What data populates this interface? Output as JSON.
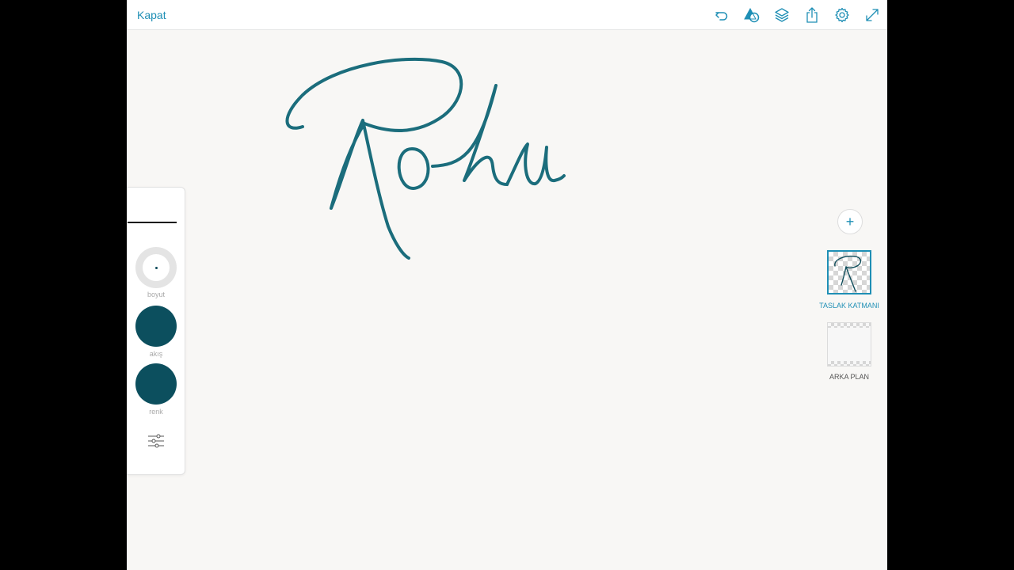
{
  "topbar": {
    "close_label": "Kapat",
    "icons": [
      "undo-icon",
      "shape-icon",
      "layers-icon",
      "share-icon",
      "gear-icon",
      "fullscreen-icon"
    ]
  },
  "brush_panel": {
    "size_label": "boyut",
    "flow_label": "akış",
    "color_label": "renk",
    "brush_color": "#0c4f5e"
  },
  "layers": {
    "add_label": "+",
    "items": [
      {
        "label": "TASLAK KATMANI",
        "selected": true
      },
      {
        "label": "ARKA PLAN",
        "selected": false
      }
    ]
  },
  "colors": {
    "accent": "#1f8fb5",
    "stroke": "#1b6d7c",
    "canvas": "#f8f7f5"
  }
}
